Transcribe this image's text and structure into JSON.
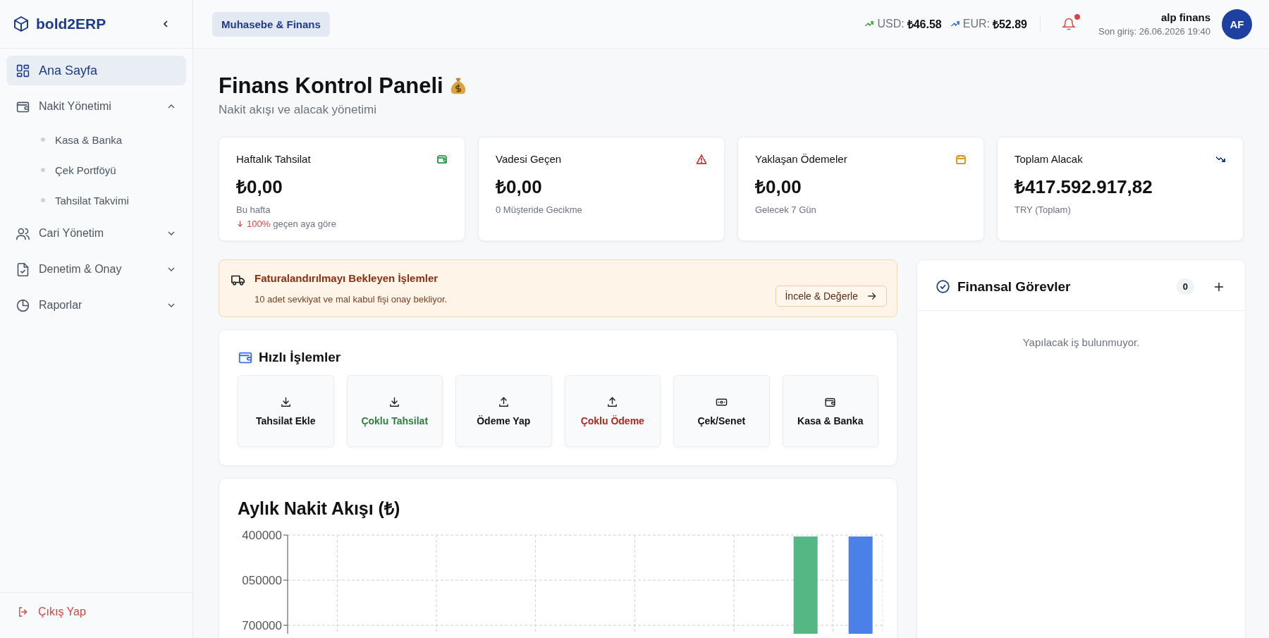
{
  "sidebar": {
    "brand": "bold2ERP",
    "items": [
      {
        "label": "Ana Sayfa",
        "kind": "link",
        "selected": true
      },
      {
        "label": "Nakit Yönetimi",
        "kind": "group",
        "selected": false,
        "expanded": true,
        "children": [
          {
            "label": "Kasa & Banka",
            "selected": false
          },
          {
            "label": "Çek Portföyü",
            "selected": false
          },
          {
            "label": "Tahsilat Takvimi",
            "selected": false
          }
        ]
      },
      {
        "label": "Cari Yönetim",
        "kind": "group",
        "selected": false,
        "expanded": false
      },
      {
        "label": "Denetim & Onay",
        "kind": "group",
        "selected": false,
        "expanded": false
      },
      {
        "label": "Raporlar",
        "kind": "group",
        "selected": false,
        "expanded": false
      }
    ],
    "logout": "Çıkış Yap"
  },
  "topbar": {
    "module": "Muhasebe & Finans",
    "rates": [
      {
        "label": "USD:",
        "value": "₺46.58",
        "color": "#4caf50"
      },
      {
        "label": "EUR:",
        "value": "₺52.89",
        "color": "#4a7fe0"
      }
    ],
    "notifications_unread": true,
    "user": {
      "name": "alp finans",
      "last_login": "Son giriş: 26.06.2026 19:40",
      "initials": "AF"
    }
  },
  "page": {
    "title": "Finans Kontrol Paneli",
    "subtitle": "Nakit akışı ve alacak yönetimi"
  },
  "stats": [
    {
      "title": "Haftalık Tahsilat",
      "value": "₺0,00",
      "note": "Bu hafta",
      "trend": {
        "value": "100%",
        "text": "geçen aya göre"
      },
      "color": "#3aa15a"
    },
    {
      "title": "Vadesi Geçen",
      "value": "₺0,00",
      "note": "0 Müşteride Gecikme",
      "color": "#d64545"
    },
    {
      "title": "Yaklaşan Ödemeler",
      "value": "₺0,00",
      "note": "Gelecek 7 Gün",
      "color": "#d99a2b"
    },
    {
      "title": "Toplam Alacak",
      "value": "₺417.592.917,82",
      "note": "TRY (Toplam)",
      "color": "#1e3a8a"
    }
  ],
  "alert": {
    "title": "Faturalandırılmayı Bekleyen İşlemler",
    "text": "10 adet sevkiyat ve mal kabul fişi onay bekliyor.",
    "button": "İncele & Değerle"
  },
  "quick_actions": {
    "title": "Hızlı İşlemler",
    "items": [
      {
        "label": "Tahsilat Ekle",
        "color": "#111111"
      },
      {
        "label": "Çoklu Tahsilat",
        "color": "#2f7d3f"
      },
      {
        "label": "Ödeme Yap",
        "color": "#111111"
      },
      {
        "label": "Çoklu Ödeme",
        "color": "#b3261e"
      },
      {
        "label": "Çek/Senet",
        "color": "#111111"
      },
      {
        "label": "Kasa & Banka",
        "color": "#111111"
      }
    ]
  },
  "cash_flow": {
    "title": "Aylık Nakit Akışı (₺)",
    "axis_labels": [
      "400000",
      "050000",
      "700000"
    ]
  },
  "tasks": {
    "title": "Finansal Görevler",
    "count": "0",
    "empty": "Yapılacak iş bulunmuyor."
  }
}
